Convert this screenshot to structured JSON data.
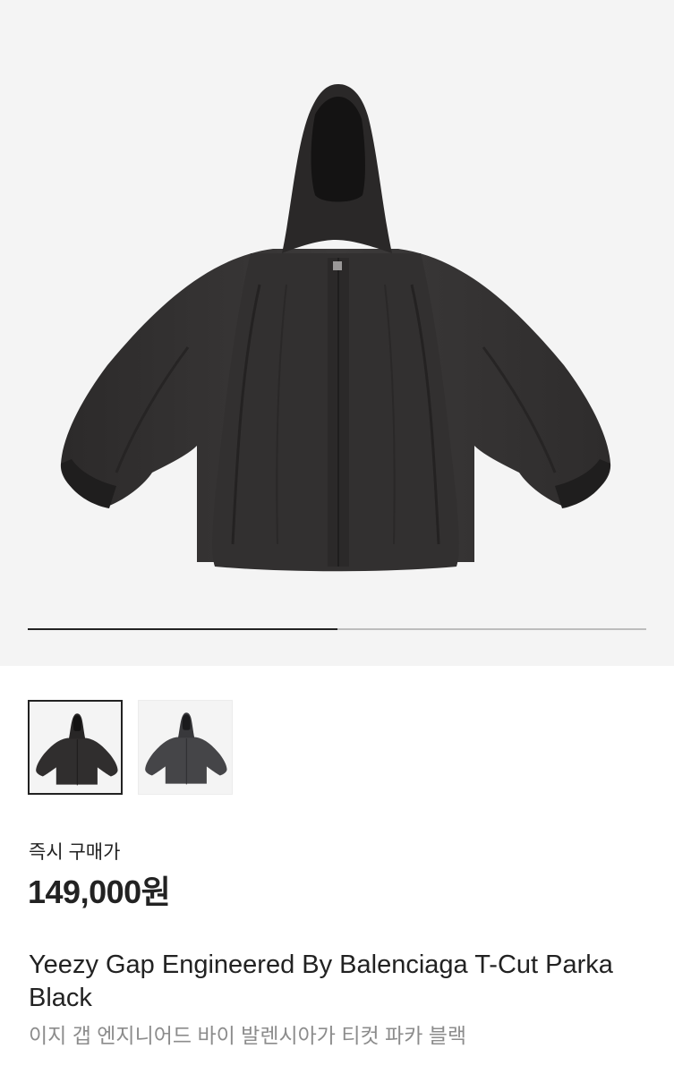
{
  "product": {
    "image_alt": "Black hooded parka",
    "gallery": {
      "progress": 0.5,
      "thumbnails": [
        {
          "selected": true,
          "tone": "#3a3838"
        },
        {
          "selected": false,
          "tone": "#4a4a4c"
        }
      ]
    },
    "price_label": "즉시 구매가",
    "price": "149,000원",
    "title_en": "Yeezy Gap Engineered By Balenciaga T-Cut Parka Black",
    "title_ko": "이지 갭 엔지니어드 바이 발렌시아가 티컷 파카 블랙"
  },
  "colors": {
    "hero_bg": "#f4f4f4",
    "progress_fill": "#222222",
    "progress_track": "#bdbdbd",
    "subtitle": "#8c8c8c"
  }
}
